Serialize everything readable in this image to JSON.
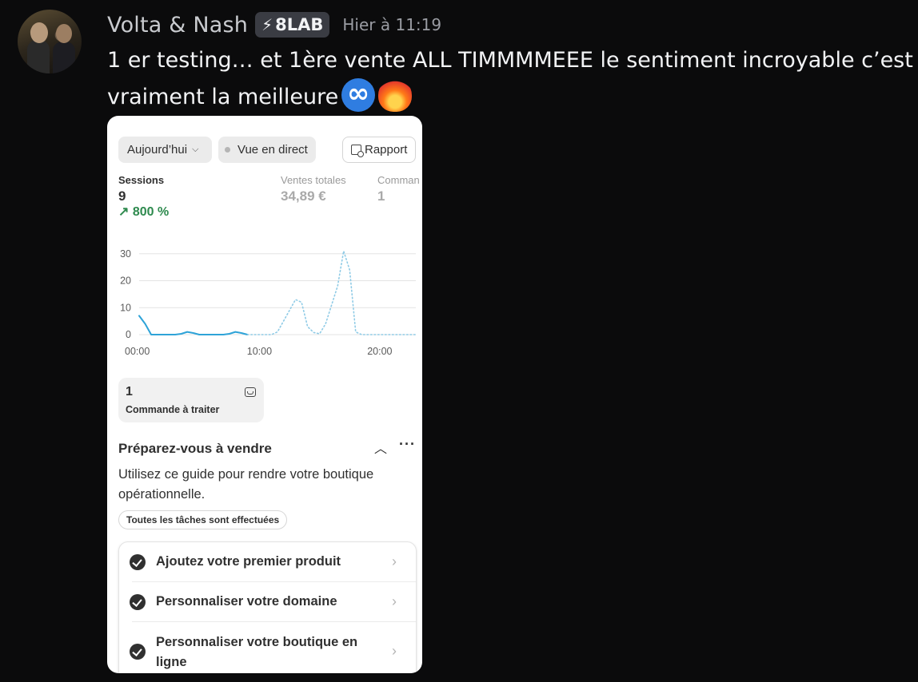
{
  "message": {
    "username": "Volta & Nash",
    "badge": {
      "icon": "lightning-bolt-icon",
      "text": "8LAB"
    },
    "timestamp": "Hier à 11:19",
    "text": "1 er testing… et 1ère vente ALL TIMMMMEEE le sentiment incroyable c’est vraiment la meilleure",
    "emojis": [
      "infinity-emoji",
      "fire-heart-emoji"
    ]
  },
  "dashboard": {
    "date_filter": "Aujourd’hui",
    "live_view": "Vue en direct",
    "report_button": "Rapport",
    "metrics": [
      {
        "label": "Sessions",
        "value": "9",
        "delta": "↗ 800 %"
      },
      {
        "label": "Ventes totales",
        "value": "34,89 €"
      },
      {
        "label": "Comman",
        "value": "1"
      }
    ],
    "orders_card": {
      "count": "1",
      "label": "Commande à traiter"
    },
    "guide": {
      "title": "Préparez-vous à vendre",
      "description": "Utilisez ce guide pour rendre votre boutique opérationnelle.",
      "status_tag": "Toutes les tâches sont effectuées",
      "tasks": [
        {
          "label": "Ajoutez votre premier produit",
          "done": true
        },
        {
          "label": "Personnaliser votre domaine",
          "done": true
        },
        {
          "label": "Personnaliser votre boutique en ligne",
          "done": true
        }
      ]
    }
  },
  "chart_data": {
    "type": "line",
    "title": "",
    "xlabel": "",
    "ylabel": "",
    "x_ticks": [
      "00:00",
      "10:00",
      "20:00"
    ],
    "y_ticks": [
      0,
      10,
      20,
      30
    ],
    "xlim": [
      0,
      23
    ],
    "ylim": [
      0,
      32
    ],
    "grid": true,
    "series": [
      {
        "style": "solid",
        "color": "#2ea3d8",
        "points": [
          [
            0,
            7
          ],
          [
            0.5,
            4
          ],
          [
            1,
            0
          ],
          [
            2,
            0
          ],
          [
            3,
            0
          ],
          [
            3.5,
            0.3
          ],
          [
            4,
            1
          ],
          [
            4.5,
            0.6
          ],
          [
            5,
            0
          ],
          [
            6,
            0
          ],
          [
            7,
            0
          ],
          [
            7.5,
            0.3
          ],
          [
            8,
            1
          ],
          [
            8.5,
            0.6
          ],
          [
            9,
            0
          ]
        ]
      },
      {
        "style": "dotted",
        "color": "#8fcbe6",
        "points": [
          [
            9,
            0
          ],
          [
            10,
            0
          ],
          [
            11,
            0
          ],
          [
            11.5,
            1
          ],
          [
            12,
            5
          ],
          [
            12.5,
            9
          ],
          [
            13,
            13
          ],
          [
            13.5,
            12
          ],
          [
            14,
            3
          ],
          [
            14.5,
            0.8
          ],
          [
            15,
            0.3
          ],
          [
            15.5,
            4
          ],
          [
            16,
            11
          ],
          [
            16.5,
            18
          ],
          [
            17,
            31
          ],
          [
            17.5,
            24
          ],
          [
            18,
            1
          ],
          [
            18.5,
            0
          ],
          [
            19,
            0
          ],
          [
            20,
            0
          ],
          [
            21,
            0
          ],
          [
            22,
            0
          ],
          [
            23,
            0
          ]
        ]
      }
    ]
  }
}
